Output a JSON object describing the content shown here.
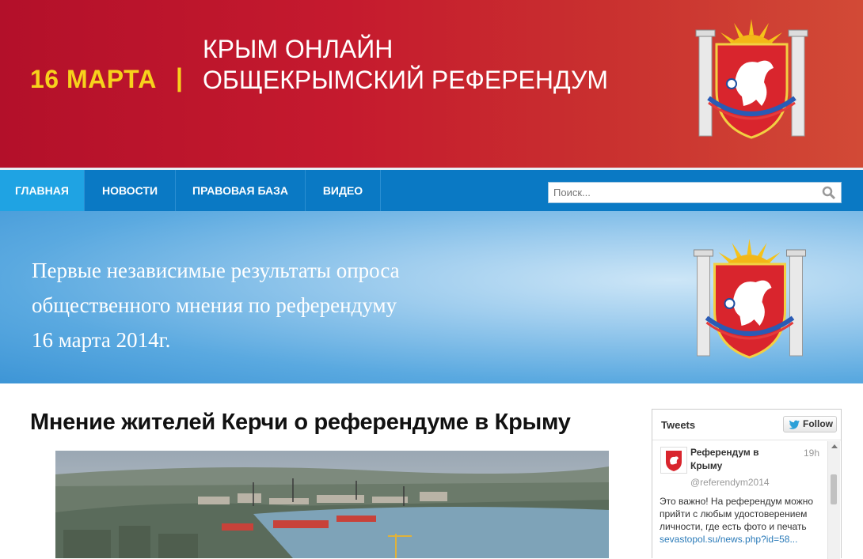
{
  "header": {
    "date": "16 МАРТА",
    "separator": "|",
    "title_line1": "КРЫМ ОНЛАЙН",
    "title_line2": "ОБЩЕКРЫМСКИЙ РЕФЕРЕНДУМ"
  },
  "nav": {
    "items": [
      {
        "label": "ГЛАВНАЯ",
        "active": true
      },
      {
        "label": "НОВОСТИ",
        "active": false
      },
      {
        "label": "ПРАВОВАЯ БАЗА",
        "active": false
      },
      {
        "label": "ВИДЕО",
        "active": false
      }
    ],
    "search_placeholder": "Поиск..."
  },
  "banner": {
    "line1": "Первые независимые результаты опроса",
    "line2": "общественного мнения по референдуму",
    "line3": "16 марта 2014г."
  },
  "article": {
    "title": "Мнение жителей Керчи о референдуме в Крыму"
  },
  "tweets": {
    "title": "Tweets",
    "follow_label": "Follow",
    "tweet": {
      "name": "Референдум в Крыму",
      "time": "19h",
      "handle": "@referendym2014",
      "text": "Это важно! На референдум можно прийти с любым удостоверением личности, где есть фото и печать",
      "link": "sevastopol.su/news.php?id=58..."
    }
  },
  "colors": {
    "header_red": "#b3102a",
    "date_yellow": "#f7d21c",
    "nav_blue": "#0a79c4",
    "nav_active": "#1fa3e3"
  }
}
